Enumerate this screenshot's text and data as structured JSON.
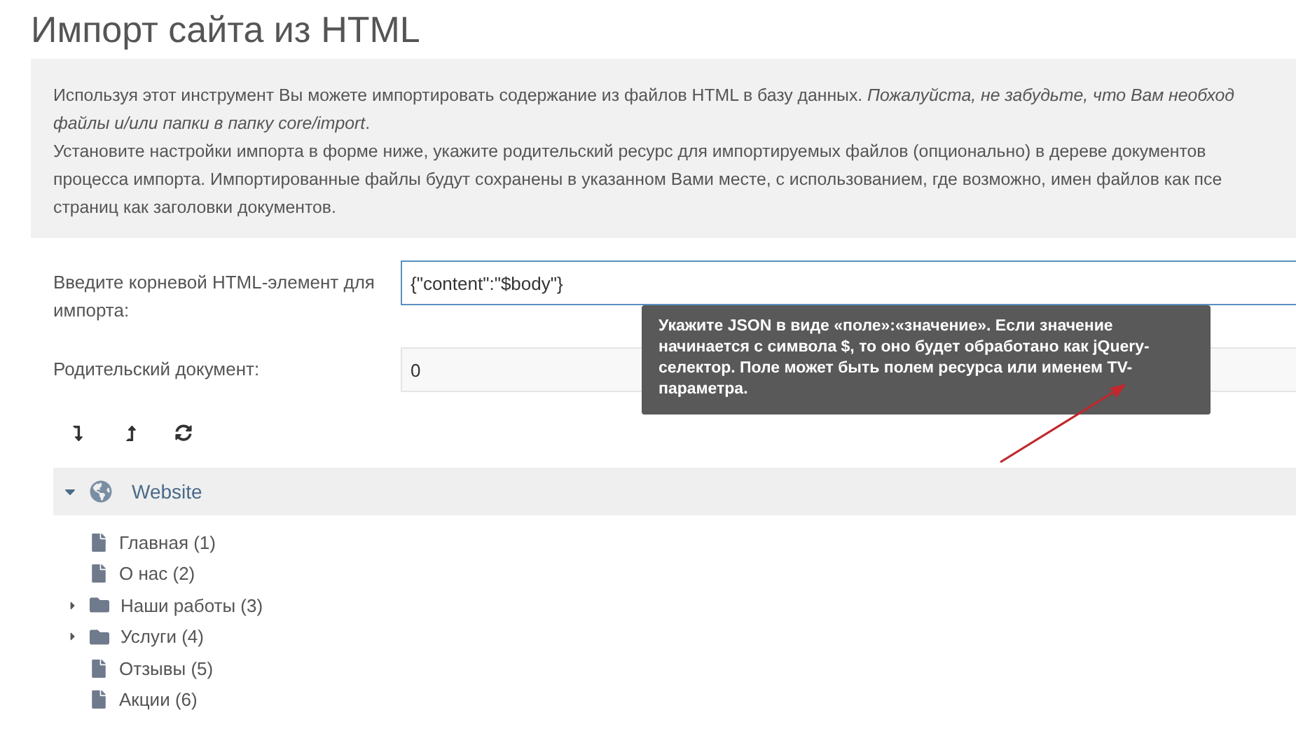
{
  "page_title": "Импорт сайта из HTML",
  "intro": {
    "lines": [
      "Используя этот инструмент Вы можете импортировать содержание из файлов HTML в базу данных. *Пожалуйста, не забудьте, что Вам необход*",
      "*файлы и/или папки в папку core/import*.",
      "Установите настройки импорта в форме ниже, укажите родительский ресурс для импортируемых файлов (опционально) в дереве документов",
      "процесса импорта. Импортированные файлы будут сохранены в указанном Вами месте, с использованием, где возможно, имен файлов как псе",
      "страниц как заголовки документов."
    ]
  },
  "form": {
    "fields": [
      {
        "label": "Введите корневой HTML-элемент для импорта:",
        "value": "{\"content\":\"$body\"}",
        "focused": true
      },
      {
        "label": "Родительский документ:",
        "value": "0",
        "focused": false
      }
    ],
    "tooltip": "Укажите JSON в виде «поле»:«значение». Если значение начинается с символа $, то оно будет обработано как jQuery-селектор. Поле может быть полем ресурса или именем TV-параметра."
  },
  "tree": {
    "root": {
      "label": "Website",
      "expanded": true
    },
    "children": [
      {
        "label": "Главная (1)",
        "kind": "page"
      },
      {
        "label": "О нас (2)",
        "kind": "page"
      },
      {
        "label": "Наши работы (3)",
        "kind": "folder",
        "expanded": false
      },
      {
        "label": "Услуги (4)",
        "kind": "folder",
        "expanded": false
      },
      {
        "label": "Отзывы (5)",
        "kind": "page"
      },
      {
        "label": "Акции (6)",
        "kind": "page"
      }
    ]
  }
}
